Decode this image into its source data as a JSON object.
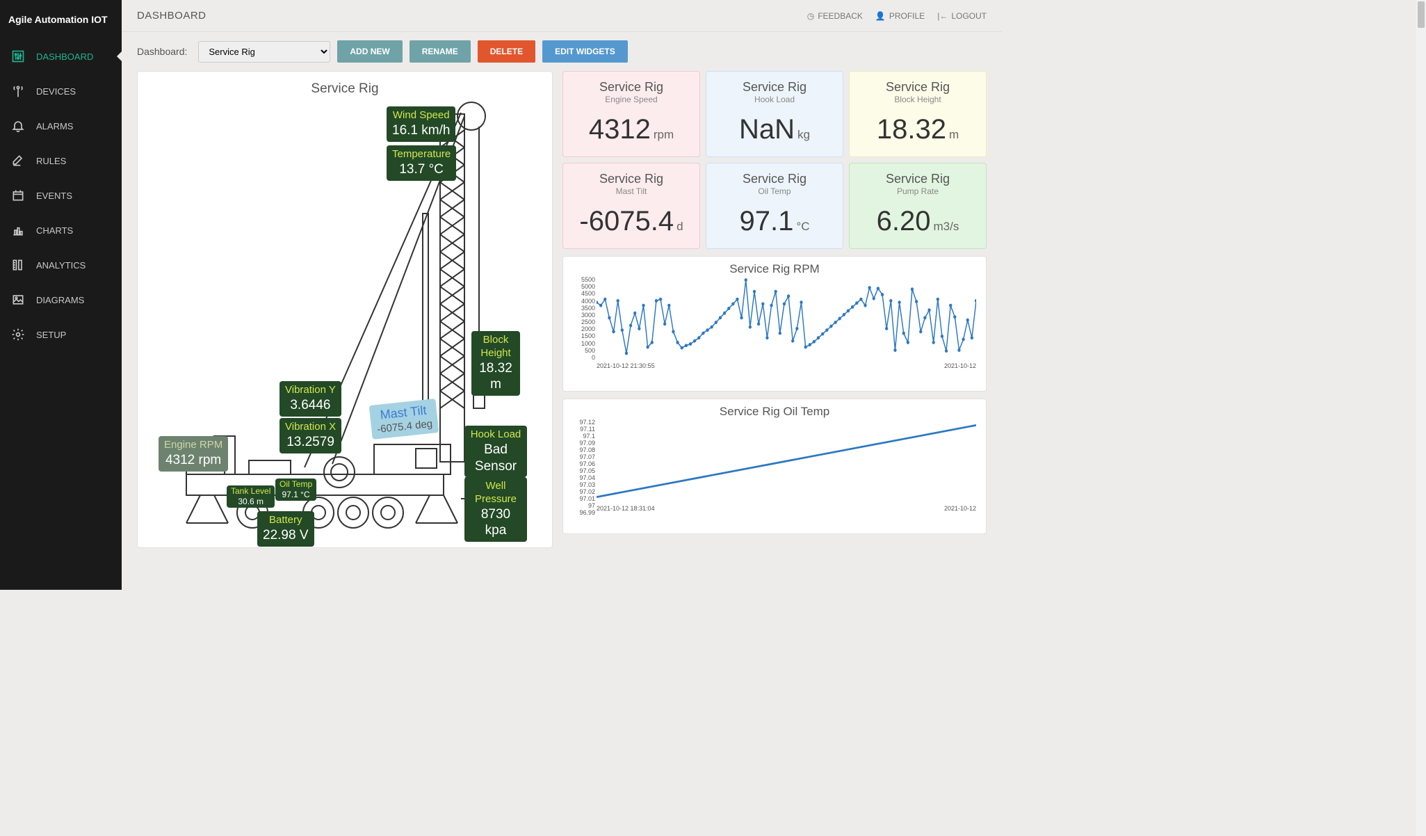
{
  "brand": "Agile Automation IOT",
  "topbar": {
    "title": "DASHBOARD",
    "links": {
      "feedback": "FEEDBACK",
      "profile": "PROFILE",
      "logout": "LOGOUT"
    }
  },
  "sidebar": {
    "items": [
      {
        "label": "DASHBOARD",
        "icon": "sliders",
        "active": true
      },
      {
        "label": "DEVICES",
        "icon": "antenna"
      },
      {
        "label": "ALARMS",
        "icon": "bell"
      },
      {
        "label": "RULES",
        "icon": "edit"
      },
      {
        "label": "EVENTS",
        "icon": "calendar"
      },
      {
        "label": "CHARTS",
        "icon": "bar"
      },
      {
        "label": "ANALYTICS",
        "icon": "ruler"
      },
      {
        "label": "DIAGRAMS",
        "icon": "image"
      },
      {
        "label": "SETUP",
        "icon": "gear"
      }
    ]
  },
  "toolbar": {
    "label": "Dashboard:",
    "selected": "Service Rig",
    "buttons": {
      "add_new": "ADD NEW",
      "rename": "RENAME",
      "delete": "DELETE",
      "edit_widgets": "EDIT WIDGETS"
    }
  },
  "diagram": {
    "title": "Service Rig",
    "tags": {
      "wind_speed": {
        "label": "Wind Speed",
        "value": "16.1 km/h"
      },
      "temperature": {
        "label": "Temperature",
        "value": "13.7 °C"
      },
      "block_height": {
        "label": "Block Height",
        "value": "18.32 m"
      },
      "mast_tilt": {
        "label": "Mast Tilt",
        "value": "-6075.4 deg"
      },
      "vibration_y": {
        "label": "Vibration Y",
        "value": "3.6446"
      },
      "vibration_x": {
        "label": "Vibration X",
        "value": "13.2579"
      },
      "hook_load": {
        "label": "Hook Load",
        "value": "Bad Sensor"
      },
      "well_pressure": {
        "label": "Well Pressure",
        "value": "8730 kpa"
      },
      "engine_rpm": {
        "label": "Engine RPM",
        "value": "4312 rpm"
      },
      "oil_temp": {
        "label": "Oil Temp",
        "value": "97.1 °C"
      },
      "tank_level": {
        "label": "Tank Level",
        "value": "30.6 m"
      },
      "battery": {
        "label": "Battery",
        "value": "22.98 V"
      }
    }
  },
  "kpis": [
    {
      "title": "Service Rig",
      "sub": "Engine Speed",
      "value": "4312",
      "unit": "rpm",
      "color": "pink"
    },
    {
      "title": "Service Rig",
      "sub": "Hook Load",
      "value": "NaN",
      "unit": "kg",
      "color": "blue"
    },
    {
      "title": "Service Rig",
      "sub": "Block Height",
      "value": "18.32",
      "unit": "m",
      "color": "yellow"
    },
    {
      "title": "Service Rig",
      "sub": "Mast Tilt",
      "value": "-6075.4",
      "unit": "d",
      "color": "pink"
    },
    {
      "title": "Service Rig",
      "sub": "Oil Temp",
      "value": "97.1",
      "unit": "°C",
      "color": "blue"
    },
    {
      "title": "Service Rig",
      "sub": "Pump Rate",
      "value": "6.20",
      "unit": "m3/s",
      "color": "green"
    }
  ],
  "chart_data": [
    {
      "type": "line",
      "title": "Service Rig RPM",
      "ylim": [
        0,
        5500
      ],
      "yticks": [
        5500,
        5000,
        4500,
        4000,
        3500,
        3000,
        2500,
        2000,
        1500,
        1000,
        500,
        0
      ],
      "xlabels": [
        "2021-10-12 21:30:55",
        "2021-10-12"
      ],
      "series": [
        {
          "name": "RPM",
          "color": "#2d78c3",
          "values": [
            3800,
            3600,
            4000,
            2800,
            1900,
            3900,
            2000,
            500,
            2300,
            3100,
            2100,
            3600,
            900,
            1200,
            3900,
            4000,
            2400,
            3600,
            1900,
            1200,
            850,
            1000,
            1100,
            1300,
            1500,
            1800,
            2000,
            2200,
            2500,
            2800,
            3100,
            3400,
            3700,
            4000,
            2800,
            5250,
            2200,
            4500,
            2400,
            3700,
            1500,
            3600,
            4500,
            1800,
            3700,
            4200,
            1300,
            2100,
            3800,
            900,
            1050,
            1250,
            1500,
            1750,
            2000,
            2250,
            2500,
            2750,
            3000,
            3250,
            3500,
            3750,
            4000,
            3600,
            4750,
            4050,
            4700,
            4300,
            2100,
            3900,
            700,
            3800,
            1800,
            1200,
            4650,
            3850,
            1900,
            2800,
            3300,
            1200,
            4000,
            1600,
            650,
            3600,
            2850,
            700,
            1400,
            2650,
            1500,
            3900
          ]
        }
      ]
    },
    {
      "type": "line",
      "title": "Service Rig Oil Temp",
      "ylim": [
        96.99,
        97.12
      ],
      "yticks": [
        97.12,
        97.11,
        97.1,
        97.09,
        97.08,
        97.07,
        97.06,
        97.05,
        97.04,
        97.03,
        97.02,
        97.01,
        97,
        96.99
      ],
      "xlabels": [
        "2021-10-12 18:31:04",
        "2021-10-12"
      ],
      "series": [
        {
          "name": "Oil Temp",
          "color": "#2d78c3",
          "values": [
            97.0,
            97.11
          ]
        }
      ]
    }
  ]
}
